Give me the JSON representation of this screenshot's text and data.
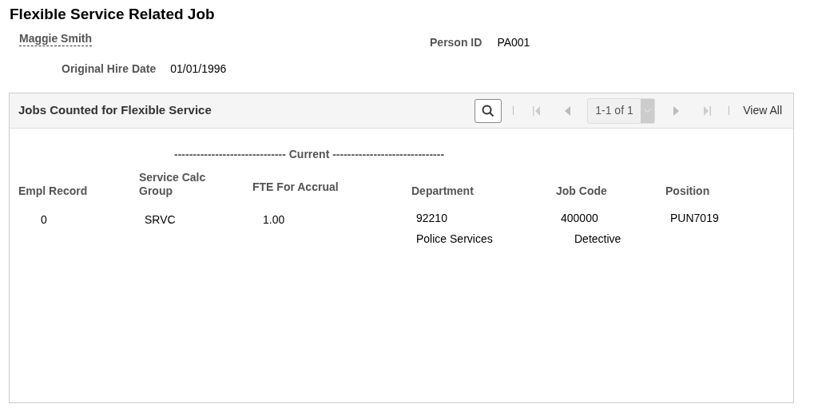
{
  "page_title": "Flexible Service Related Job",
  "person": {
    "name": "Maggie Smith",
    "person_id_label": "Person ID",
    "person_id": "PA001",
    "hire_date_label": "Original Hire Date",
    "hire_date": "01/01/1996"
  },
  "grid": {
    "title": "Jobs Counted for Flexible Service",
    "page_range": "1-1 of 1",
    "view_all": "View All",
    "group_heading": "------------------------------ Current ------------------------------",
    "columns": [
      "Empl Record",
      "Service Calc Group",
      "FTE For Accrual",
      "Department",
      "Job Code",
      "Position"
    ],
    "rows": [
      {
        "empl_record": "0",
        "service_calc_group": "SRVC",
        "fte": "1.00",
        "department": "92210",
        "department_desc": "Police Services",
        "job_code": "400000",
        "job_code_desc": "Detective",
        "position": "PUN7019"
      }
    ]
  }
}
